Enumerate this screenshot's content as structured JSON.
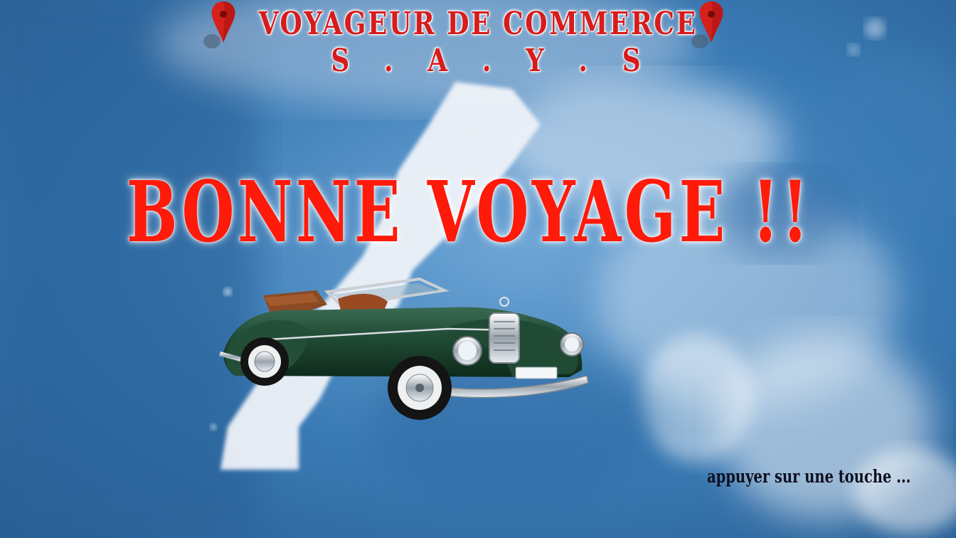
{
  "header": {
    "title": "VOYAGEUR DE COMMERCE",
    "subtitle": "S . A . Y . S"
  },
  "headline": "BONNE VOYAGE !!",
  "prompt": "appuyer sur une touche ...",
  "icons": {
    "left_pin": "map-pin-icon",
    "right_pin": "map-pin-icon",
    "car": "vintage-convertible-car"
  },
  "colors": {
    "title_red": "#d61c1c",
    "headline_red": "#ff1a0a",
    "background_blue": "#2f6fa6",
    "car_green": "#1f4a33",
    "prompt_text": "#0d1020"
  }
}
